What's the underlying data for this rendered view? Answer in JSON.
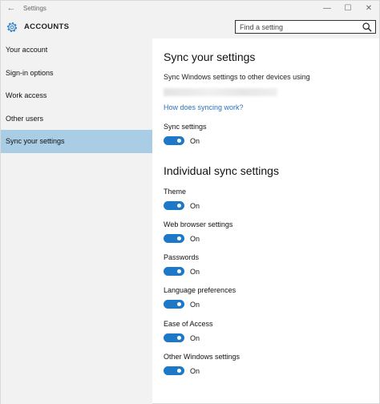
{
  "window": {
    "title": "Settings",
    "back_glyph": "←",
    "minimize_glyph": "—",
    "maximize_glyph": "☐",
    "close_glyph": "✕"
  },
  "header": {
    "icon": "gear-icon",
    "section": "ACCOUNTS",
    "search_placeholder": "Find a setting",
    "search_value": ""
  },
  "sidebar": {
    "items": [
      {
        "label": "Your account",
        "active": false
      },
      {
        "label": "Sign-in options",
        "active": false
      },
      {
        "label": "Work access",
        "active": false
      },
      {
        "label": "Other users",
        "active": false
      },
      {
        "label": "Sync your settings",
        "active": true
      }
    ]
  },
  "main": {
    "title": "Sync your settings",
    "description": "Sync Windows settings to other devices using",
    "link": "How does syncing work?",
    "sync_settings": {
      "label": "Sync settings",
      "state": "On"
    },
    "individual_title": "Individual sync settings",
    "individual": [
      {
        "label": "Theme",
        "state": "On"
      },
      {
        "label": "Web browser settings",
        "state": "On"
      },
      {
        "label": "Passwords",
        "state": "On"
      },
      {
        "label": "Language preferences",
        "state": "On"
      },
      {
        "label": "Ease of Access",
        "state": "On"
      },
      {
        "label": "Other Windows settings",
        "state": "On"
      }
    ]
  },
  "colors": {
    "accent": "#1e78c8",
    "link": "#2a72c0",
    "selected_nav": "#a8cde4",
    "chrome": "#f2f2f2"
  }
}
